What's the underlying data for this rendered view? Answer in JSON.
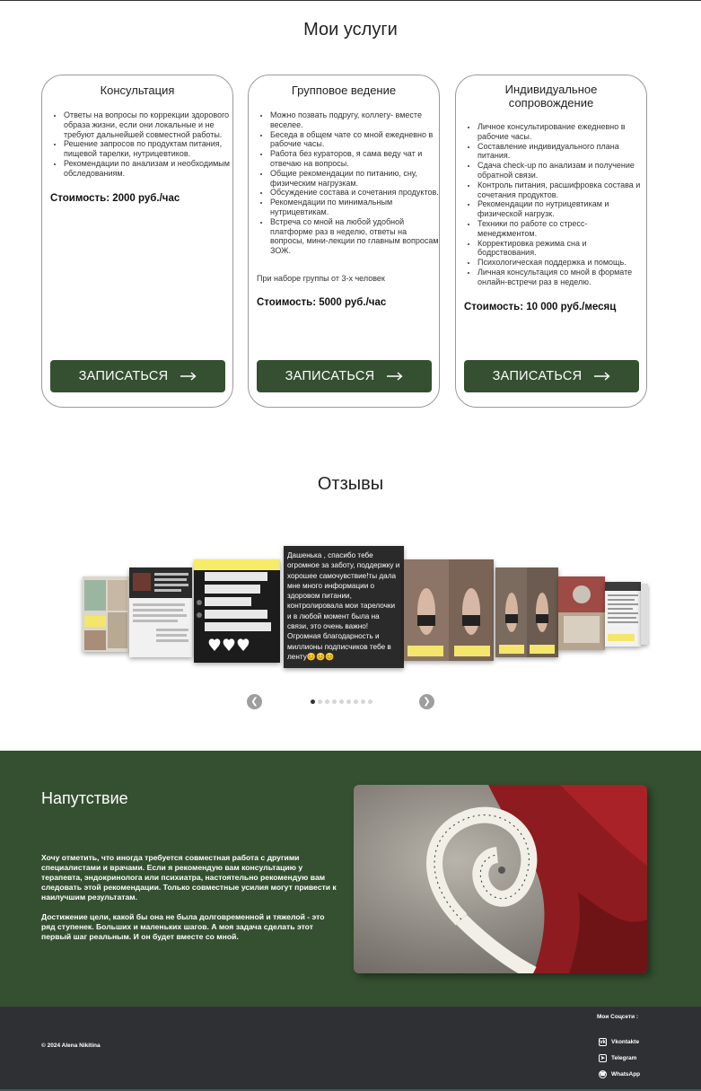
{
  "services": {
    "title": "Мои услуги",
    "cta_label": "ЗАПИСАТЬСЯ",
    "cards": [
      {
        "title": "Консультация",
        "items": [
          "Ответы на вопросы по коррекции здорового образа жизни, если они локальные и не требуют дальнейшей совместной работы.",
          "Решение запросов по продуктам питания, пищевой тарелки, нутрицевтиков.",
          "Рекомендации по анализам и необходимым обследованиям."
        ],
        "note": "",
        "price": "Стоимость: 2000 руб./час"
      },
      {
        "title": "Групповое ведение",
        "items": [
          "Можно позвать подругу, коллегу- вместе веселее.",
          "Беседа в общем чате со мной ежедневно в рабочие часы.",
          "Работа без кураторов, я сама веду чат и отвечаю на вопросы.",
          "Общие рекомендации по питанию, сну, физическим нагрузкам.",
          "Обсуждение состава и сочетания продуктов.",
          "Рекомендации по минимальным нутрицевтикам.",
          "Встреча со мной на любой удобной платформе раз в неделю, ответы на вопросы, мини-лекции по главным вопросам ЗОЖ."
        ],
        "note": "При наборе группы от 3-х человек",
        "price": "Стоимость: 5000 руб./час"
      },
      {
        "title": "Индивидуальное сопровождение",
        "items": [
          "Личное консультирование ежедневно в рабочие часы.",
          "Составление индивидуального плана питания.",
          "Сдача check-up по анализам и получение обратной связи.",
          "Контроль питания, расшифровка состава и сочетания продуктов.",
          "Рекомендации по нутрицевтикам и физической нагрузк.",
          "Техники по работе со стресс- менеджментом.",
          "Корректировка режима сна и бодрствования.",
          "Психологическая поддержка и помощь.",
          "Личная консультация со мной в формате онлайн-встречи раз в неделю."
        ],
        "note": "",
        "price": "Стоимость: 10 000 руб./месяц"
      }
    ]
  },
  "reviews": {
    "title": "Отзывы",
    "center_slide_text": "Дашенька , спасибо тебе огромное за заботу, поддержку и хорошее самочувствие!ты дала мне много информации о здоровом питании, контролировала мои тарелочки и в любой момент была на связи, это очень важно! Огромная благодарность и миллионы подписчиков тебе в ленту😊😊😊",
    "slide_count": 9,
    "active_index": 0,
    "prev_icon": "chevron-left-icon",
    "next_icon": "chevron-right-icon"
  },
  "advice": {
    "title": "Напутствие",
    "paragraphs": [
      "Хочу отметить, что иногда требуется совместная работа с другими специалистами и врачами. Если я рекомендую вам консультацию у терапевта, эндокринолога или психиатра, настоятельно рекомендую вам следовать этой рекомендации. Только совместные усилия могут привести к наилучшим результатам.",
      "Достижение цели, какой бы она не была долговременной и тяжелой - это ряд ступенек. Больших и маленьких шагов. А моя задача сделать этот первый шаг реальным. И он будет вместе со мной."
    ]
  },
  "footer": {
    "copyright": "© 2024 Alena Nikitina",
    "socials_title": "Мои Соцсети :",
    "socials": [
      {
        "label": "Vkontakte",
        "icon": "vk-icon"
      },
      {
        "label": "Telegram",
        "icon": "telegram-icon"
      },
      {
        "label": "WhatsApp",
        "icon": "whatsapp-icon"
      }
    ]
  },
  "colors": {
    "accent": "#345030",
    "footer_bg": "#2e3033"
  }
}
